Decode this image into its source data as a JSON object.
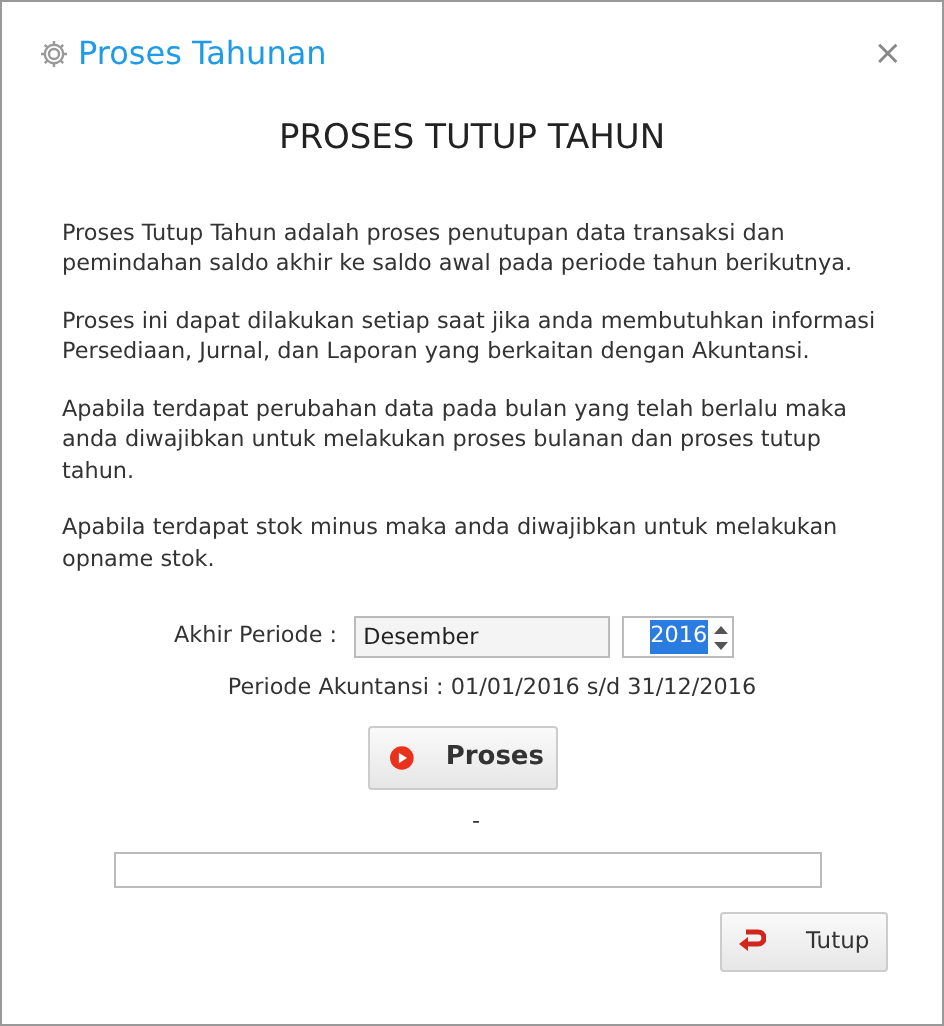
{
  "window": {
    "title": "Proses Tahunan",
    "close": "×"
  },
  "heading": "PROSES TUTUP TAHUN",
  "paragraphs": [
    "Proses Tutup Tahun adalah proses penutupan data transaksi dan pemindahan saldo akhir ke saldo awal pada periode tahun berikutnya.",
    "Proses ini dapat dilakukan setiap saat jika anda membutuhkan informasi Persediaan, Jurnal, dan Laporan yang berkaitan dengan Akuntansi.",
    "Apabila terdapat perubahan data pada bulan yang telah berlalu maka anda diwajibkan untuk melakukan proses bulanan dan proses tutup tahun.",
    "Apabila terdapat stok minus maka anda diwajibkan untuk melakukan opname stok."
  ],
  "period": {
    "label": "Akhir Periode :",
    "month": "Desember",
    "year": "2016",
    "year_text_selected": true
  },
  "accounting_period": "Periode Akuntansi : 01/01/2016 s/d 31/12/2016",
  "process_button": "Proses",
  "status": "-",
  "progress": {
    "level": 0
  },
  "close_button": "Tutup"
}
